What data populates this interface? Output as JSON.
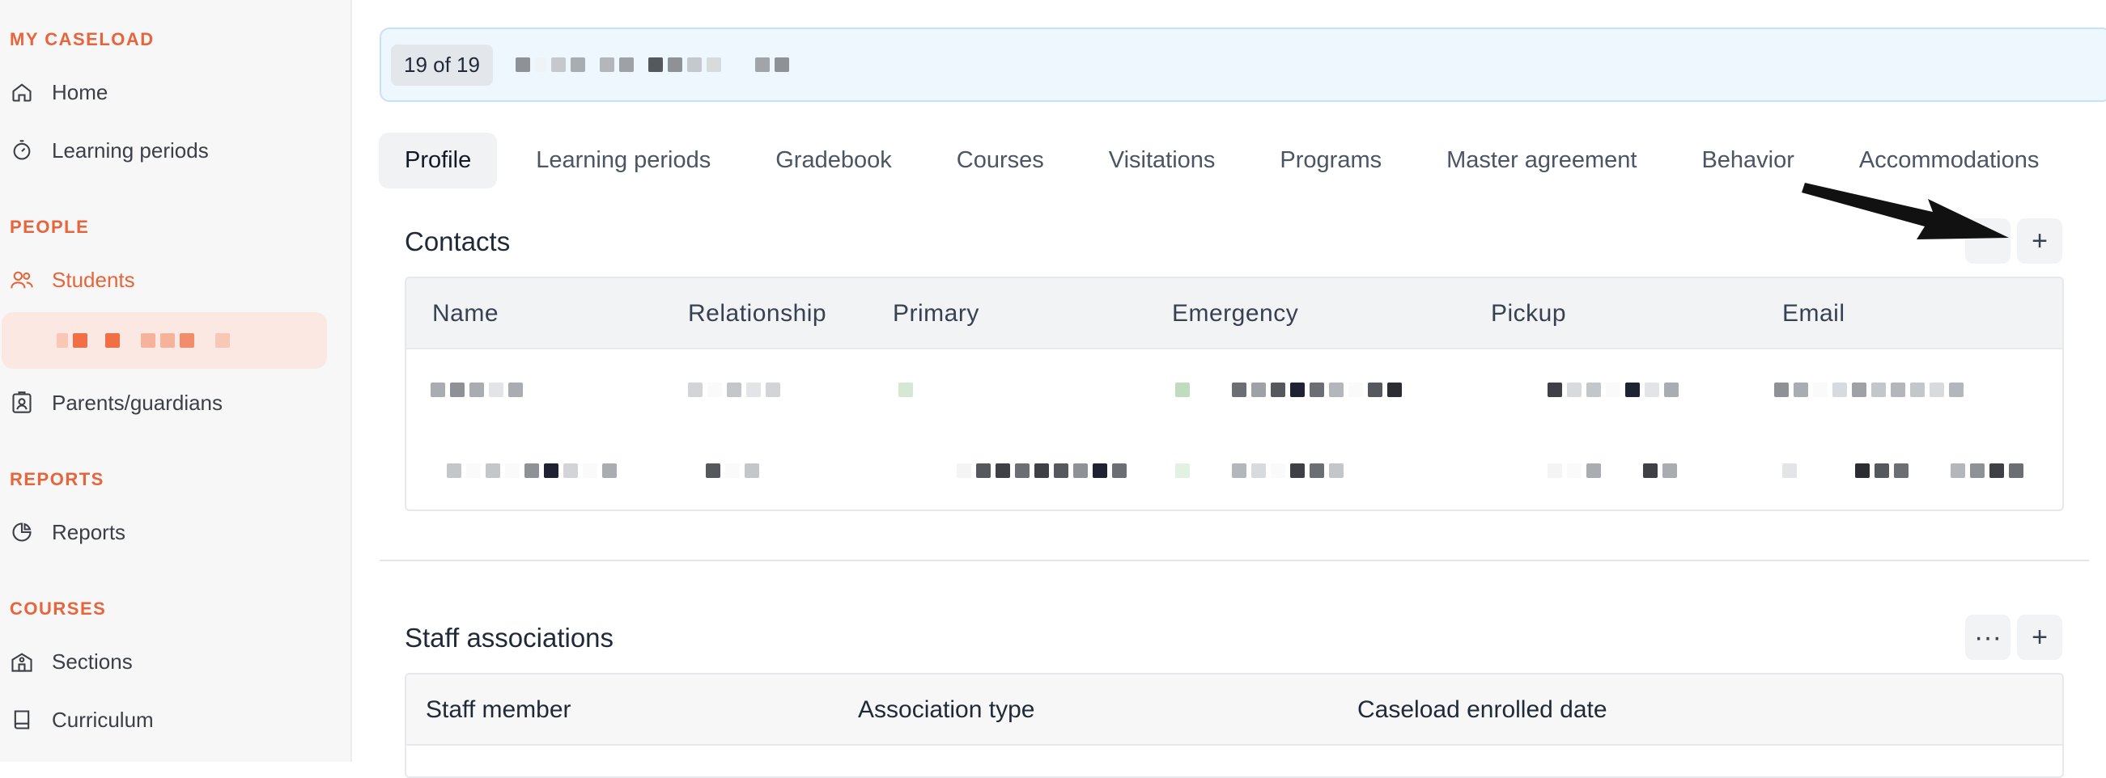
{
  "sidebar": {
    "sections": [
      {
        "label": "MY CASELOAD"
      },
      {
        "label": "PEOPLE"
      },
      {
        "label": "REPORTS"
      },
      {
        "label": "COURSES"
      }
    ],
    "items": [
      {
        "label": "Home",
        "icon": "home-icon"
      },
      {
        "label": "Learning periods",
        "icon": "timer-icon"
      },
      {
        "label": "Students",
        "icon": "users-icon"
      },
      {
        "label": "Parents/guardians",
        "icon": "id-badge-icon"
      },
      {
        "label": "Reports",
        "icon": "pie-chart-icon"
      },
      {
        "label": "Sections",
        "icon": "school-icon"
      },
      {
        "label": "Curriculum",
        "icon": "book-icon"
      }
    ]
  },
  "banner": {
    "count": "19 of 19"
  },
  "tabs": [
    {
      "label": "Profile"
    },
    {
      "label": "Learning periods"
    },
    {
      "label": "Gradebook"
    },
    {
      "label": "Courses"
    },
    {
      "label": "Visitations"
    },
    {
      "label": "Programs"
    },
    {
      "label": "Master agreement"
    },
    {
      "label": "Behavior"
    },
    {
      "label": "Accommodations"
    }
  ],
  "contacts": {
    "title": "Contacts",
    "add_label": "+",
    "columns": [
      "Name",
      "Relationship",
      "Primary",
      "Emergency",
      "Pickup",
      "Email"
    ]
  },
  "staff": {
    "title": "Staff associations",
    "more_label": "···",
    "add_label": "+",
    "columns": [
      "Staff member",
      "Association type",
      "Caseload enrolled date"
    ]
  },
  "colors": {
    "accent": "#e8643a",
    "banner_bg": "#eff7fe"
  }
}
